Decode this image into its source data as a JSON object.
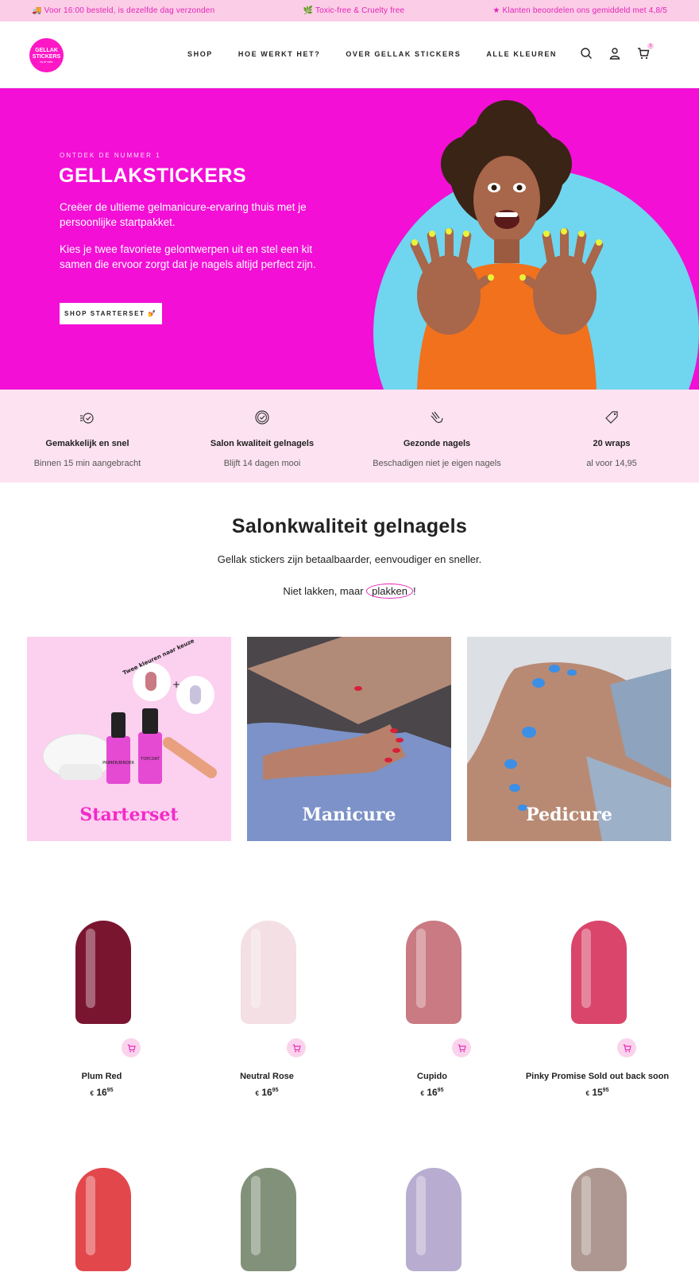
{
  "announcement": {
    "left": "🚚 Voor 16:00 besteld, is dezelfde dag verzonden",
    "center": "🌿 Toxic-free & Cruelty free",
    "right": "★ Klanten beoordelen ons gemiddeld met 4,8/5"
  },
  "header": {
    "logo_line1": "GELLAK",
    "logo_line2": "STICKERS",
    "logo_tag": "by dr nailz",
    "nav": [
      "SHOP",
      "HOE WERKT HET?",
      "OVER GELLAK STICKERS",
      "ALLE KLEUREN"
    ],
    "cart_count": "0",
    "icons": [
      "search-icon",
      "account-icon",
      "cart-icon"
    ]
  },
  "hero": {
    "kicker": "ONTDEK DE NUMMER 1",
    "title": "GELLAKSTICKERS",
    "p1": "Creëer de ultieme gelmanicure-ervaring thuis met je persoonlijke startpakket.",
    "p2": "Kies je twee favoriete gelontwerpen uit en stel een kit samen die ervoor zorgt dat je nagels altijd perfect zijn.",
    "button": "SHOP STARTERSET 💅"
  },
  "features": [
    {
      "title": "Gemakkelijk en snel",
      "subtitle": "Binnen 15 min aangebracht",
      "icon": "timer-icon"
    },
    {
      "title": "Salon kwaliteit gelnagels",
      "subtitle": "Blijft 14 dagen mooi",
      "icon": "quality-badge-icon"
    },
    {
      "title": "Gezonde nagels",
      "subtitle": "Beschadigen niet je eigen nagels",
      "icon": "hand-nail-icon"
    },
    {
      "title": "20 wraps",
      "subtitle": "al voor 14,95",
      "icon": "price-tag-icon"
    }
  ],
  "section": {
    "title": "Salonkwaliteit gelnagels",
    "subtitle": "Gellak stickers zijn betaalbaarder, eenvoudiger en sneller.",
    "tagline_pre": "Niet lakken, maar ",
    "tagline_circled": "plakken",
    "tagline_post": "!"
  },
  "categories": [
    {
      "label": "Starterset",
      "promo_text": "Twee kleuren naar keuze",
      "bottle1": "PRIMER/BINDER",
      "bottle2": "TOPCOAT"
    },
    {
      "label": "Manicure"
    },
    {
      "label": "Pedicure"
    }
  ],
  "products": [
    {
      "name": "Plum Red",
      "price_main": "16",
      "price_cents": "95",
      "color": "#7a1530"
    },
    {
      "name": "Neutral Rose",
      "price_main": "16",
      "price_cents": "95",
      "color": "#f3dfe4"
    },
    {
      "name": "Cupido",
      "price_main": "16",
      "price_cents": "95",
      "color": "#c97a82"
    },
    {
      "name": "Pinky Promise Sold out back soon",
      "price_main": "15",
      "price_cents": "95",
      "color": "#d9456b"
    },
    {
      "color": "#e2474c"
    },
    {
      "color": "#82927a"
    },
    {
      "color": "#b8add0"
    },
    {
      "color": "#ad9790"
    }
  ],
  "currency": "€"
}
